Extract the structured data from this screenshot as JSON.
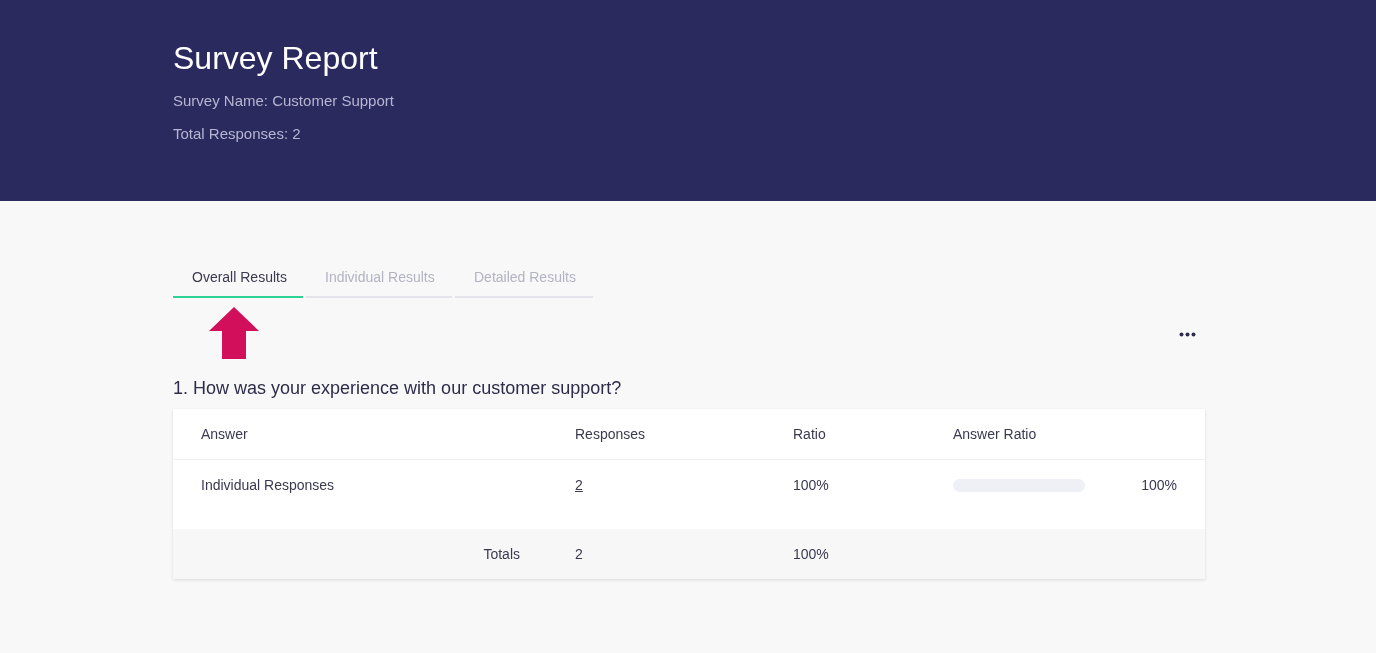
{
  "header": {
    "title": "Survey Report",
    "survey_name": "Survey Name: Customer Support",
    "total_responses": "Total Responses: 2"
  },
  "tabs": [
    {
      "label": "Overall Results",
      "selected": true
    },
    {
      "label": "Individual Results",
      "selected": false
    },
    {
      "label": "Detailed Results",
      "selected": false
    }
  ],
  "question": {
    "title": "1. How was your experience with our customer support?",
    "table": {
      "columns": [
        "Answer",
        "Responses",
        "Ratio",
        "Answer Ratio"
      ],
      "rows": [
        {
          "answer": "Individual Responses",
          "responses": "2",
          "ratio": "100%",
          "answer_ratio": "100%"
        }
      ],
      "totals": {
        "label": "Totals",
        "responses": "2",
        "ratio": "100%"
      }
    }
  }
}
